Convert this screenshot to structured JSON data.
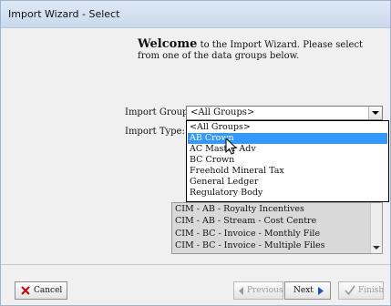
{
  "window": {
    "title": "Import Wizard - Select"
  },
  "welcome": {
    "heading": "Welcome",
    "text": "to the Import Wizard.  Please select from one of the data groups below."
  },
  "form": {
    "import_group_label": "Import Group:",
    "import_group_value": "<All Groups>",
    "import_type_label": "Import Type:"
  },
  "dropdown": {
    "items": [
      "<All Groups>",
      "AB Crown",
      "AC Master Adv",
      "BC Crown",
      "Freehold Mineral Tax",
      "General Ledger",
      "Regulatory Body"
    ],
    "highlighted": "AB Crown"
  },
  "import_types": [
    "CIM - AB - Royalty Incentives",
    "CIM - AB - Stream - Cost Centre",
    "CIM - BC - Invoice - Monthly File",
    "CIM - BC - Invoice - Multiple Files"
  ],
  "buttons": {
    "cancel": "Cancel",
    "previous": "Previous",
    "next": "Next",
    "finish": "Finish"
  },
  "colors": {
    "selection": "#3399ff",
    "title_bar": "#c9d9ec",
    "cancel_x": "#d00000",
    "next_arrow": "#1a4fd1",
    "finish_check": "#8aa08a"
  },
  "icons": {
    "cancel": "red-x-icon",
    "previous": "left-arrow-icon",
    "next": "right-arrow-icon",
    "finish": "checkmark-icon",
    "cursor": "mouse-pointer-icon"
  }
}
